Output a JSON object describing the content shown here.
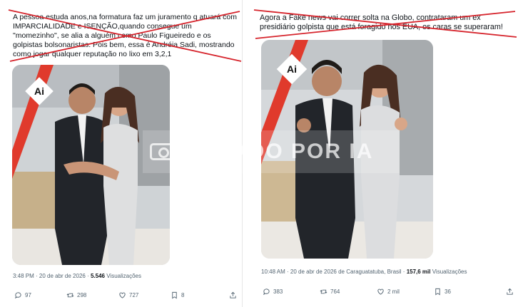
{
  "colors": {
    "strike_red": "#d6242c",
    "meta_gray": "#536471",
    "text_dark": "#0f1419"
  },
  "left_post": {
    "text": "A pessoa estuda anos,na formatura faz um juramento q atuará com IMPARCIALIDADE e ISENÇÃO,quando consegue um \"momezinho\", se alia a alguém como Paulo Figueiredo e os golpistas bolsonaristas. Pois bem, essa é Andréia Sadi, mostrando como jogar qualquer reputação no lixo em 3,2,1",
    "badge": "Ai",
    "meta_time": "3:48 PM · 20 de abr de 2026 · ",
    "meta_views_count": "5.546",
    "meta_views_label": " Visualizações",
    "actions": {
      "replies": "97",
      "reposts": "298",
      "likes": "727",
      "bookmarks": "8"
    },
    "icons": [
      "reply-icon",
      "repost-icon",
      "like-icon",
      "bookmark-icon",
      "share-icon"
    ]
  },
  "right_post": {
    "text": "Agora a Fake news vai correr solta na Globo, contrataram um ex presidiário golpista que está foragido nos EUA, os caras se superaram!",
    "badge": "Ai",
    "meta_time": "10:48 AM · 20 de abr de 2026 de Caraguatatuba, Brasil · ",
    "meta_views_count": "157,6 mil",
    "meta_views_label": " Visualizações",
    "actions": {
      "replies": "383",
      "reposts": "764",
      "likes": "2 mil",
      "bookmarks": "36"
    },
    "icons": [
      "reply-icon",
      "repost-icon",
      "like-icon",
      "bookmark-icon",
      "share-icon"
    ]
  },
  "watermark": {
    "text": "GERADO POR IA"
  }
}
